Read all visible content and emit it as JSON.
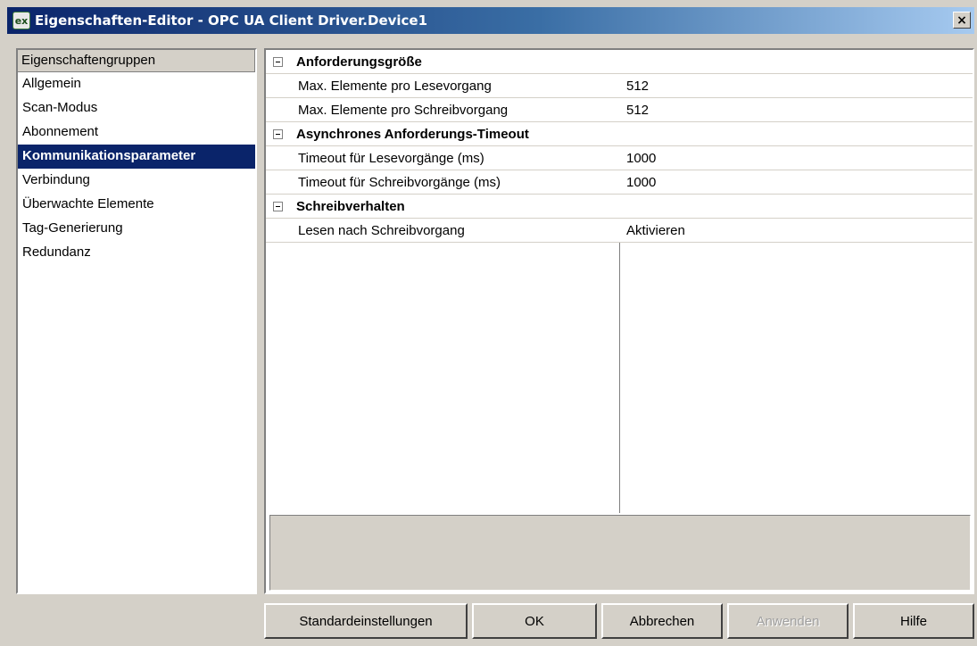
{
  "window": {
    "icon_text": "ex",
    "title": "Eigenschaften-Editor - OPC UA Client Driver.Device1",
    "close_label": "×"
  },
  "sidebar": {
    "header": "Eigenschaftengruppen",
    "items": [
      {
        "label": "Allgemein"
      },
      {
        "label": "Scan-Modus"
      },
      {
        "label": "Abonnement"
      },
      {
        "label": "Kommunikationsparameter",
        "selected": true
      },
      {
        "label": "Verbindung"
      },
      {
        "label": "Überwachte Elemente"
      },
      {
        "label": "Tag-Generierung"
      },
      {
        "label": "Redundanz"
      }
    ]
  },
  "property_grid": {
    "groups": [
      {
        "title": "Anforderungsgröße",
        "properties": [
          {
            "name": "Max. Elemente pro Lesevorgang",
            "value": "512"
          },
          {
            "name": "Max. Elemente pro Schreibvorgang",
            "value": "512"
          }
        ]
      },
      {
        "title": "Asynchrones Anforderungs-Timeout",
        "properties": [
          {
            "name": "Timeout für Lesevorgänge (ms)",
            "value": "1000"
          },
          {
            "name": "Timeout für Schreibvorgänge (ms)",
            "value": "1000"
          }
        ]
      },
      {
        "title": "Schreibverhalten",
        "properties": [
          {
            "name": "Lesen nach Schreibvorgang",
            "value": "Aktivieren"
          }
        ]
      }
    ]
  },
  "buttons": {
    "defaults": "Standardeinstellungen",
    "ok": "OK",
    "cancel": "Abbrechen",
    "apply": "Anwenden",
    "help": "Hilfe"
  },
  "colors": {
    "selection": "#0a246a",
    "face": "#d4d0c8"
  }
}
